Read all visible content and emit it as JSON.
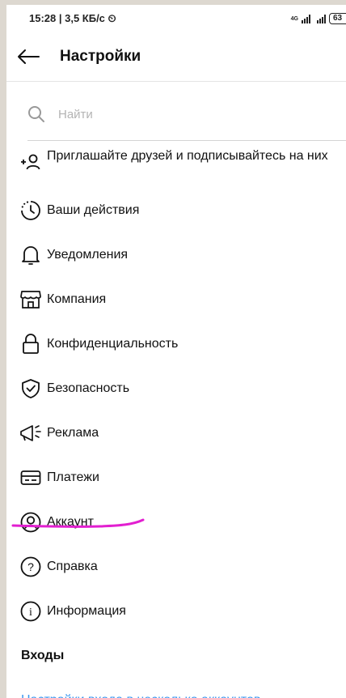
{
  "status": {
    "time_info": "15:28 | 3,5 КБ/с ⏲",
    "network": "4G",
    "battery": "63"
  },
  "header": {
    "title": "Настройки"
  },
  "search": {
    "placeholder": "Найти"
  },
  "menu": [
    {
      "label": "Приглашайте друзей и подписывайтесь на них",
      "icon": "add-person-icon"
    },
    {
      "label": "Ваши действия",
      "icon": "activity-clock-icon"
    },
    {
      "label": "Уведомления",
      "icon": "bell-icon"
    },
    {
      "label": "Компания",
      "icon": "shop-icon"
    },
    {
      "label": "Конфиденциальность",
      "icon": "lock-icon"
    },
    {
      "label": "Безопасность",
      "icon": "shield-check-icon"
    },
    {
      "label": "Реклама",
      "icon": "megaphone-icon"
    },
    {
      "label": "Платежи",
      "icon": "card-icon"
    },
    {
      "label": "Аккаунт",
      "icon": "account-circle-icon"
    },
    {
      "label": "Справка",
      "icon": "help-circle-icon"
    },
    {
      "label": "Информация",
      "icon": "info-circle-icon"
    }
  ],
  "logins": {
    "section_title": "Входы",
    "multi_account_link": "Настройки входа в несколько аккаунтов"
  },
  "colors": {
    "link": "#3897f0",
    "annotation_underline": "#e21fd0"
  }
}
